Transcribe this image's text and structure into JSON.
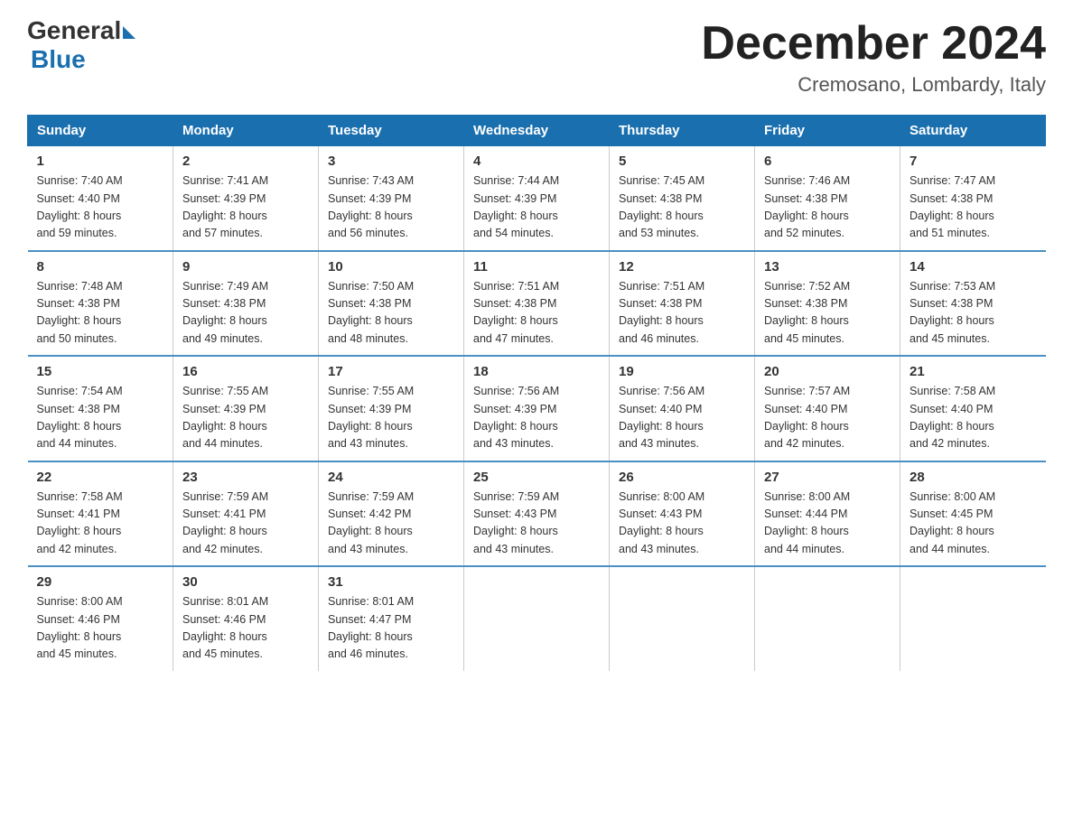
{
  "logo": {
    "general": "General",
    "blue": "Blue"
  },
  "header": {
    "title": "December 2024",
    "location": "Cremosano, Lombardy, Italy"
  },
  "days_of_week": [
    "Sunday",
    "Monday",
    "Tuesday",
    "Wednesday",
    "Thursday",
    "Friday",
    "Saturday"
  ],
  "weeks": [
    [
      {
        "date": "1",
        "sunrise": "Sunrise: 7:40 AM",
        "sunset": "Sunset: 4:40 PM",
        "daylight": "Daylight: 8 hours",
        "daylight2": "and 59 minutes."
      },
      {
        "date": "2",
        "sunrise": "Sunrise: 7:41 AM",
        "sunset": "Sunset: 4:39 PM",
        "daylight": "Daylight: 8 hours",
        "daylight2": "and 57 minutes."
      },
      {
        "date": "3",
        "sunrise": "Sunrise: 7:43 AM",
        "sunset": "Sunset: 4:39 PM",
        "daylight": "Daylight: 8 hours",
        "daylight2": "and 56 minutes."
      },
      {
        "date": "4",
        "sunrise": "Sunrise: 7:44 AM",
        "sunset": "Sunset: 4:39 PM",
        "daylight": "Daylight: 8 hours",
        "daylight2": "and 54 minutes."
      },
      {
        "date": "5",
        "sunrise": "Sunrise: 7:45 AM",
        "sunset": "Sunset: 4:38 PM",
        "daylight": "Daylight: 8 hours",
        "daylight2": "and 53 minutes."
      },
      {
        "date": "6",
        "sunrise": "Sunrise: 7:46 AM",
        "sunset": "Sunset: 4:38 PM",
        "daylight": "Daylight: 8 hours",
        "daylight2": "and 52 minutes."
      },
      {
        "date": "7",
        "sunrise": "Sunrise: 7:47 AM",
        "sunset": "Sunset: 4:38 PM",
        "daylight": "Daylight: 8 hours",
        "daylight2": "and 51 minutes."
      }
    ],
    [
      {
        "date": "8",
        "sunrise": "Sunrise: 7:48 AM",
        "sunset": "Sunset: 4:38 PM",
        "daylight": "Daylight: 8 hours",
        "daylight2": "and 50 minutes."
      },
      {
        "date": "9",
        "sunrise": "Sunrise: 7:49 AM",
        "sunset": "Sunset: 4:38 PM",
        "daylight": "Daylight: 8 hours",
        "daylight2": "and 49 minutes."
      },
      {
        "date": "10",
        "sunrise": "Sunrise: 7:50 AM",
        "sunset": "Sunset: 4:38 PM",
        "daylight": "Daylight: 8 hours",
        "daylight2": "and 48 minutes."
      },
      {
        "date": "11",
        "sunrise": "Sunrise: 7:51 AM",
        "sunset": "Sunset: 4:38 PM",
        "daylight": "Daylight: 8 hours",
        "daylight2": "and 47 minutes."
      },
      {
        "date": "12",
        "sunrise": "Sunrise: 7:51 AM",
        "sunset": "Sunset: 4:38 PM",
        "daylight": "Daylight: 8 hours",
        "daylight2": "and 46 minutes."
      },
      {
        "date": "13",
        "sunrise": "Sunrise: 7:52 AM",
        "sunset": "Sunset: 4:38 PM",
        "daylight": "Daylight: 8 hours",
        "daylight2": "and 45 minutes."
      },
      {
        "date": "14",
        "sunrise": "Sunrise: 7:53 AM",
        "sunset": "Sunset: 4:38 PM",
        "daylight": "Daylight: 8 hours",
        "daylight2": "and 45 minutes."
      }
    ],
    [
      {
        "date": "15",
        "sunrise": "Sunrise: 7:54 AM",
        "sunset": "Sunset: 4:38 PM",
        "daylight": "Daylight: 8 hours",
        "daylight2": "and 44 minutes."
      },
      {
        "date": "16",
        "sunrise": "Sunrise: 7:55 AM",
        "sunset": "Sunset: 4:39 PM",
        "daylight": "Daylight: 8 hours",
        "daylight2": "and 44 minutes."
      },
      {
        "date": "17",
        "sunrise": "Sunrise: 7:55 AM",
        "sunset": "Sunset: 4:39 PM",
        "daylight": "Daylight: 8 hours",
        "daylight2": "and 43 minutes."
      },
      {
        "date": "18",
        "sunrise": "Sunrise: 7:56 AM",
        "sunset": "Sunset: 4:39 PM",
        "daylight": "Daylight: 8 hours",
        "daylight2": "and 43 minutes."
      },
      {
        "date": "19",
        "sunrise": "Sunrise: 7:56 AM",
        "sunset": "Sunset: 4:40 PM",
        "daylight": "Daylight: 8 hours",
        "daylight2": "and 43 minutes."
      },
      {
        "date": "20",
        "sunrise": "Sunrise: 7:57 AM",
        "sunset": "Sunset: 4:40 PM",
        "daylight": "Daylight: 8 hours",
        "daylight2": "and 42 minutes."
      },
      {
        "date": "21",
        "sunrise": "Sunrise: 7:58 AM",
        "sunset": "Sunset: 4:40 PM",
        "daylight": "Daylight: 8 hours",
        "daylight2": "and 42 minutes."
      }
    ],
    [
      {
        "date": "22",
        "sunrise": "Sunrise: 7:58 AM",
        "sunset": "Sunset: 4:41 PM",
        "daylight": "Daylight: 8 hours",
        "daylight2": "and 42 minutes."
      },
      {
        "date": "23",
        "sunrise": "Sunrise: 7:59 AM",
        "sunset": "Sunset: 4:41 PM",
        "daylight": "Daylight: 8 hours",
        "daylight2": "and 42 minutes."
      },
      {
        "date": "24",
        "sunrise": "Sunrise: 7:59 AM",
        "sunset": "Sunset: 4:42 PM",
        "daylight": "Daylight: 8 hours",
        "daylight2": "and 43 minutes."
      },
      {
        "date": "25",
        "sunrise": "Sunrise: 7:59 AM",
        "sunset": "Sunset: 4:43 PM",
        "daylight": "Daylight: 8 hours",
        "daylight2": "and 43 minutes."
      },
      {
        "date": "26",
        "sunrise": "Sunrise: 8:00 AM",
        "sunset": "Sunset: 4:43 PM",
        "daylight": "Daylight: 8 hours",
        "daylight2": "and 43 minutes."
      },
      {
        "date": "27",
        "sunrise": "Sunrise: 8:00 AM",
        "sunset": "Sunset: 4:44 PM",
        "daylight": "Daylight: 8 hours",
        "daylight2": "and 44 minutes."
      },
      {
        "date": "28",
        "sunrise": "Sunrise: 8:00 AM",
        "sunset": "Sunset: 4:45 PM",
        "daylight": "Daylight: 8 hours",
        "daylight2": "and 44 minutes."
      }
    ],
    [
      {
        "date": "29",
        "sunrise": "Sunrise: 8:00 AM",
        "sunset": "Sunset: 4:46 PM",
        "daylight": "Daylight: 8 hours",
        "daylight2": "and 45 minutes."
      },
      {
        "date": "30",
        "sunrise": "Sunrise: 8:01 AM",
        "sunset": "Sunset: 4:46 PM",
        "daylight": "Daylight: 8 hours",
        "daylight2": "and 45 minutes."
      },
      {
        "date": "31",
        "sunrise": "Sunrise: 8:01 AM",
        "sunset": "Sunset: 4:47 PM",
        "daylight": "Daylight: 8 hours",
        "daylight2": "and 46 minutes."
      },
      {
        "date": "",
        "sunrise": "",
        "sunset": "",
        "daylight": "",
        "daylight2": ""
      },
      {
        "date": "",
        "sunrise": "",
        "sunset": "",
        "daylight": "",
        "daylight2": ""
      },
      {
        "date": "",
        "sunrise": "",
        "sunset": "",
        "daylight": "",
        "daylight2": ""
      },
      {
        "date": "",
        "sunrise": "",
        "sunset": "",
        "daylight": "",
        "daylight2": ""
      }
    ]
  ]
}
